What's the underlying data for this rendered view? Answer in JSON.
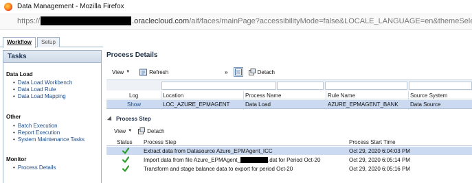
{
  "window": {
    "title": "Data Management - Mozilla Firefox"
  },
  "browser": {
    "url_prefix": "https://",
    "url_host": ".oraclecloud.com",
    "url_rest": "/aif/faces/mainPage?accessibilityMode=false&LOCALE_LANGUAGE=en&themeSele"
  },
  "tabs": {
    "workflow": "Workflow",
    "setup": "Setup"
  },
  "tasks": {
    "header": "Tasks",
    "sections": [
      {
        "title": "Data Load",
        "items": [
          "Data Load Workbench",
          "Data Load Rule",
          "Data Load Mapping"
        ]
      },
      {
        "title": "Other",
        "items": [
          "Batch Execution",
          "Report Execution",
          "System Maintenance Tasks"
        ]
      },
      {
        "title": "Monitor",
        "items": [
          "Process Details"
        ]
      }
    ]
  },
  "process_details": {
    "title": "Process Details",
    "toolbar": {
      "view": "View",
      "refresh": "Refresh",
      "more": "»",
      "detach": "Detach"
    },
    "columns": [
      "Log",
      "Location",
      "Process Name",
      "Rule Name",
      "Source System"
    ],
    "rows": [
      {
        "log": "Show",
        "location": "LOC_AZURE_EPMAGENT",
        "process_name": "Data Load",
        "rule_name": "AZURE_EPMAGENT_BANK",
        "source_system": "Data Source"
      }
    ]
  },
  "process_step": {
    "title": "Process Step",
    "toolbar": {
      "view": "View",
      "detach": "Detach"
    },
    "columns": [
      "Status",
      "Process Step",
      "Process Start Time"
    ],
    "rows": [
      {
        "status": "success",
        "step": "Extract data from Datasource Azure_EPMAgent_ICC",
        "time": "Oct 29, 2020 6:04:03 PM"
      },
      {
        "status": "success",
        "step_prefix": "Import data from file Azure_EPMAgent_",
        "step_suffix": ".dat for Period Oct-20",
        "time": "Oct 29, 2020 6:05:14 PM"
      },
      {
        "status": "success",
        "step": "Transform and stage balance data to export for period Oct-20",
        "time": "Oct 29, 2020 6:05:16 PM"
      }
    ]
  },
  "colors": {
    "accent": "#1a4b8a",
    "selected_row": "#cbdaf0",
    "success": "#2e9b2e"
  }
}
